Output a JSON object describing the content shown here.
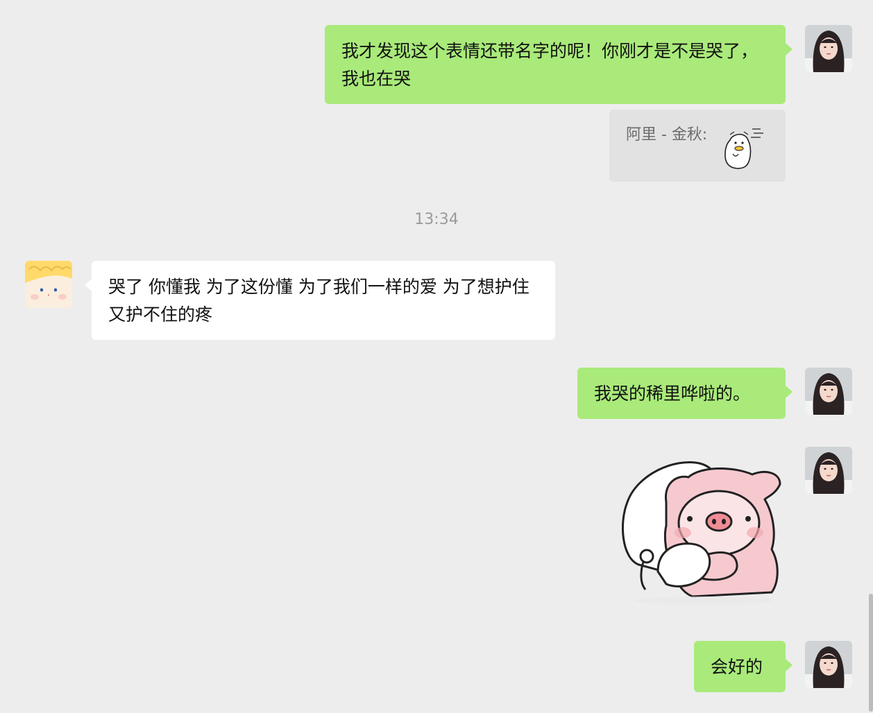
{
  "colors": {
    "background": "#ededed",
    "my_bubble": "#a9ea7a",
    "other_bubble": "#ffffff",
    "quote_bg": "#e2e2e2",
    "timestamp": "#9a9a9a"
  },
  "messages": {
    "m1": {
      "text": "我才发现这个表情还带名字的呢！你刚才是不是哭了，我也在哭"
    },
    "quote": {
      "label": "阿里 - 金秋:",
      "sticker_icon": "duck-sticker-icon"
    },
    "timestamp": "13:34",
    "m2": {
      "text": "哭了 你懂我 为了这份懂 为了我们一样的爱 为了想护住又护不住的疼"
    },
    "m3": {
      "text": "我哭的稀里哗啦的。"
    },
    "m4": {
      "sticker_icon": "pig-hug-sticker-icon"
    },
    "m5": {
      "text": "会好的"
    }
  },
  "avatars": {
    "me": "girl-photo-avatar",
    "other": "cartoon-face-avatar"
  }
}
